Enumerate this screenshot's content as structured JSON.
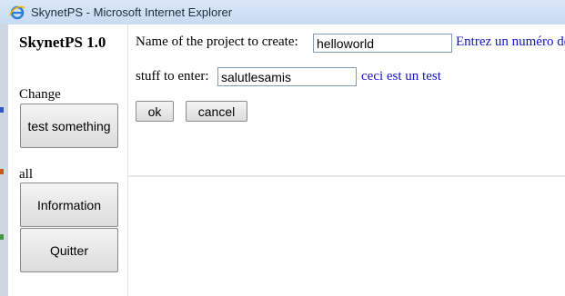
{
  "window": {
    "title": "SkynetPS - Microsoft Internet Explorer"
  },
  "sidebar": {
    "app_title": "SkynetPS 1.0",
    "change_label": "Change",
    "test_button": "test something",
    "all_label": "all",
    "information_button": "Information",
    "quit_button": "Quitter"
  },
  "form": {
    "project_label": "Name of the project to create:",
    "project_value": "helloworld",
    "project_hint": "Entrez un numéro de",
    "stuff_label": "stuff to enter:",
    "stuff_value": "salutlesamis",
    "stuff_hint": "ceci est un test",
    "ok_button": "ok",
    "cancel_button": "cancel"
  },
  "colors": {
    "hint": "#1414c8",
    "titlebar": "#d9e7f7"
  }
}
